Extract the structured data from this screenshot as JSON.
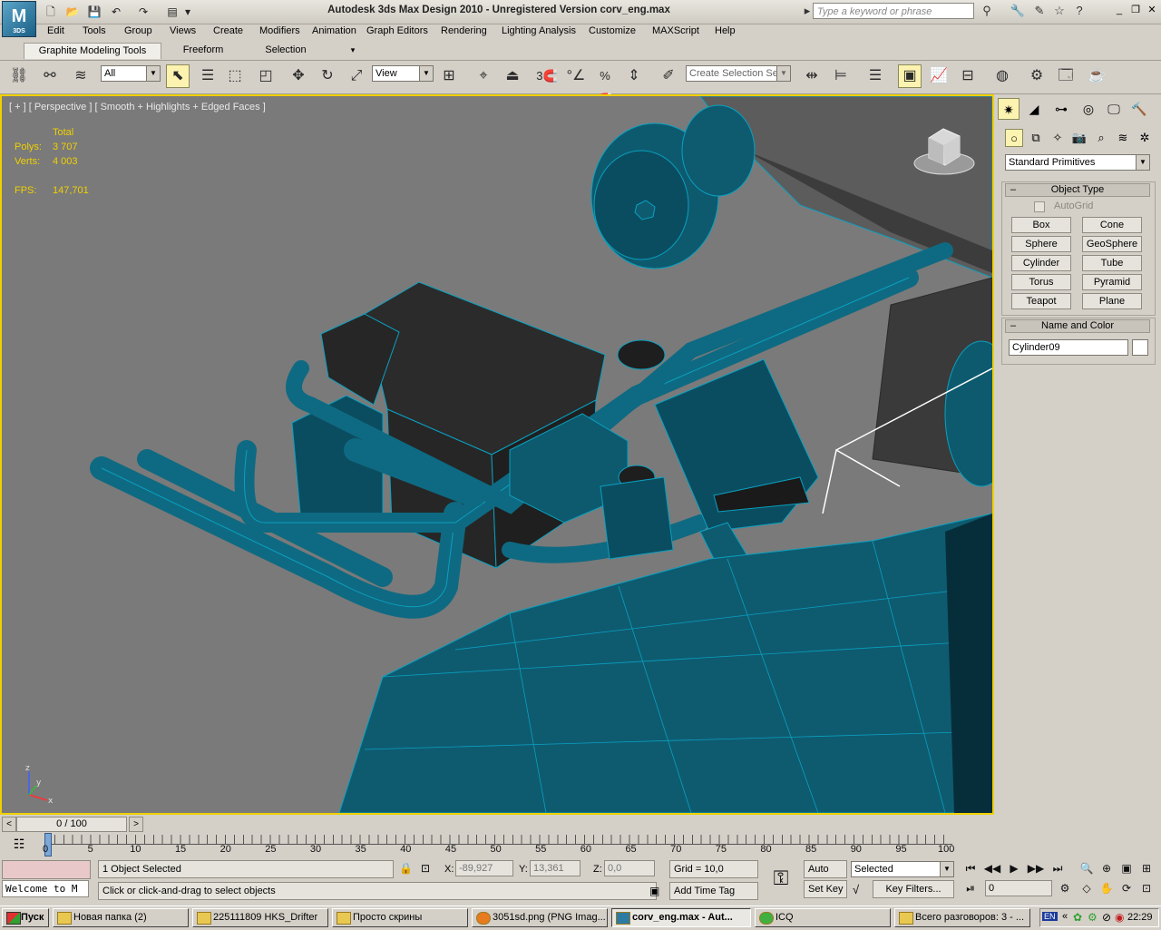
{
  "titlebar": {
    "title": "Autodesk 3ds Max Design 2010  -  Unregistered Version     corv_eng.max",
    "logo_text": "M",
    "logo_sub": "3DS",
    "search_placeholder": "Type a keyword or phrase"
  },
  "menu": [
    "Edit",
    "Tools",
    "Group",
    "Views",
    "Create",
    "Modifiers",
    "Animation",
    "Graph Editors",
    "Rendering",
    "Lighting Analysis",
    "Customize",
    "MAXScript",
    "Help"
  ],
  "ribbon": {
    "tabs": [
      "Graphite Modeling Tools",
      "Freeform",
      "Selection"
    ]
  },
  "toolbar": {
    "filter_value": "All",
    "refcoord_value": "View",
    "named_selection_placeholder": "Create Selection Se",
    "snap_3": "3",
    "snap_deg": "°",
    "snap_pct": "%"
  },
  "viewport": {
    "label": "[ + ] [ Perspective ] [ Smooth + Highlights + Edged Faces ]",
    "stats": {
      "total_label": "Total",
      "polys_label": "Polys:",
      "polys_value": "3 707",
      "verts_label": "Verts:",
      "verts_value": "4 003",
      "fps_label": "FPS:",
      "fps_value": "147,701"
    },
    "colors": {
      "model": "#0e5b70",
      "dark_box": "#2a2a2a",
      "background": "#7a7a7a",
      "active_border": "#f0d000"
    }
  },
  "command_panel": {
    "dropdown_value": "Standard Primitives",
    "object_type_header": "Object Type",
    "autogrid_label": "AutoGrid",
    "primitives": [
      "Box",
      "Cone",
      "Sphere",
      "GeoSphere",
      "Cylinder",
      "Tube",
      "Torus",
      "Pyramid",
      "Teapot",
      "Plane"
    ],
    "name_color_header": "Name and Color",
    "object_name": "Cylinder09"
  },
  "timeline": {
    "frame_label": "0 / 100",
    "ticks": [
      "0",
      "5",
      "10",
      "15",
      "20",
      "25",
      "30",
      "35",
      "40",
      "45",
      "50",
      "55",
      "60",
      "65",
      "70",
      "75",
      "80",
      "85",
      "90",
      "95",
      "100"
    ]
  },
  "status": {
    "maxscript_listener": "Welcome to M",
    "selection_status": "1 Object Selected",
    "prompt": "Click or click-and-drag to select objects",
    "x_label": "X:",
    "x_value": "-89,927",
    "y_label": "Y:",
    "y_value": "13,361",
    "z_label": "Z:",
    "z_value": "0,0",
    "grid": "Grid = 10,0",
    "add_time_tag": "Add Time Tag",
    "auto_key": "Auto Key",
    "set_key": "Set Key",
    "selected_value": "Selected",
    "key_filters": "Key Filters...",
    "current_frame": "0"
  },
  "taskbar": {
    "start": "Пуск",
    "tasks": [
      "Новая папка (2)",
      "225111809 HKS_Drifter",
      "Просто скрины",
      "3051sd.png (PNG Imag...",
      "corv_eng.max - Aut...",
      "ICQ",
      "Всего разговоров: 3 - ..."
    ],
    "lang": "EN",
    "clock": "22:29"
  }
}
